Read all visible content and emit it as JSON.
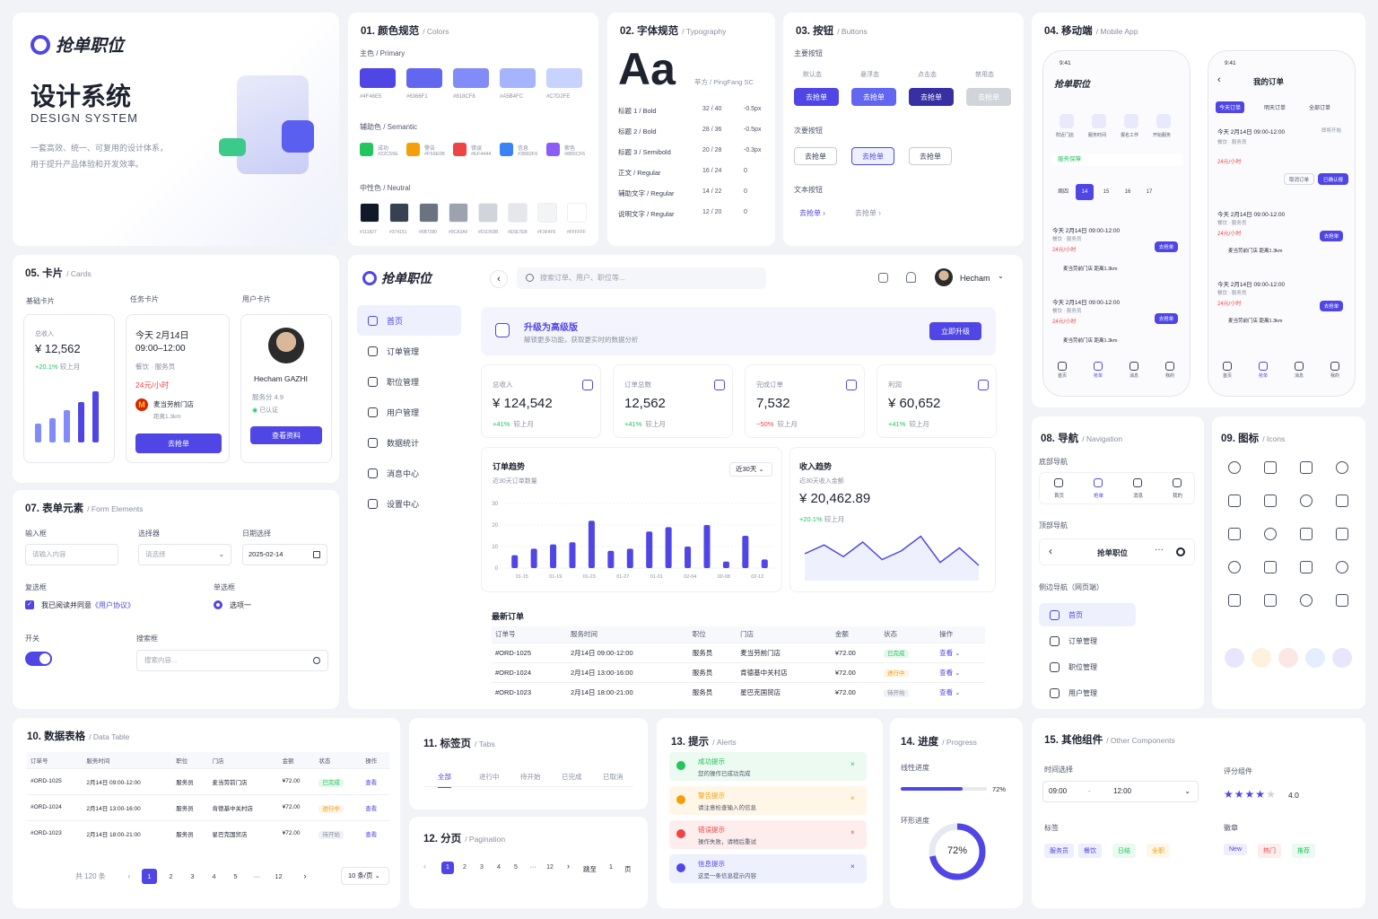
{
  "brand": {
    "name": "抢单职位",
    "title": "设计系统",
    "title_en": "DESIGN SYSTEM",
    "desc1": "一套高效、统一、可复用的设计体系，",
    "desc2": "用于提升产品体验和开发效率。"
  },
  "colors": {
    "header": "01. 颜色规范",
    "header_sub": "/ Colors",
    "primary_label": "主色 / Primary",
    "primary": [
      "#4F46E5",
      "#6366F1",
      "#818CF8",
      "#A5B4FC",
      "#C7D2FE"
    ],
    "semantic_label": "辅助色 / Semantic",
    "semantic": [
      {
        "name": "成功",
        "hex": "#22C55E"
      },
      {
        "name": "警告",
        "hex": "#F59E0B"
      },
      {
        "name": "错误",
        "hex": "#EF4444"
      },
      {
        "name": "信息",
        "hex": "#3B82F6"
      },
      {
        "name": "紫色",
        "hex": "#8B5CF6"
      }
    ],
    "neutral_label": "中性色 / Neutral",
    "neutral": [
      "#111827",
      "#374151",
      "#6B7280",
      "#9CA3AF",
      "#D1D5DB",
      "#E5E7EB",
      "#F3F4F6",
      "#FFFFFF"
    ]
  },
  "typography": {
    "header": "02. 字体规范",
    "header_sub": "/ Typography",
    "sample": "Aa",
    "font": "苹方 / PingFang SC",
    "rows": [
      [
        "标题 1 / Bold",
        "32 / 40",
        "-0.5px"
      ],
      [
        "标题 2 / Bold",
        "28 / 36",
        "-0.5px"
      ],
      [
        "标题 3 / Semibold",
        "20 / 28",
        "-0.3px"
      ],
      [
        "正文 / Regular",
        "16 / 24",
        "0"
      ],
      [
        "辅助文字 / Regular",
        "14 / 22",
        "0"
      ],
      [
        "说明文字 / Regular",
        "12 / 20",
        "0"
      ]
    ]
  },
  "buttons": {
    "header": "03. 按钮",
    "header_sub": "/ Buttons",
    "primary_label": "主要按钮",
    "states": [
      "默认态",
      "悬浮态",
      "点击态",
      "禁用态"
    ],
    "label": "去抢单",
    "secondary_label": "次要按钮",
    "text_label": "文本按钮",
    "text_btn": "去抢单 ›"
  },
  "mobile": {
    "header": "04. 移动端",
    "header_sub": "/ Mobile App",
    "time": "9:41",
    "brand": "抢单职位",
    "orders_title": "我的订单",
    "tabs": [
      "今天订单",
      "明天订单",
      "全部订单"
    ],
    "home_tabs": [
      "附近门店",
      "服务时间",
      "报名工作",
      "开始服务"
    ],
    "banner": "服务保障",
    "dates": [
      "周四",
      "14",
      "15",
      "16",
      "17"
    ],
    "job_time": "今天 2月14日 09:00-12:00",
    "job_role": "餐饮 · 服务员",
    "job_price": "24元/小时",
    "job_store": "麦当劳前门店",
    "job_dist": "距离1.3km",
    "grab": "去抢单",
    "order_btn": "已确认报",
    "order_status": "即将开始",
    "order_cancel": "取消订单",
    "nav": [
      "首页",
      "抢单",
      "消息",
      "我的"
    ]
  },
  "cards": {
    "header": "05. 卡片",
    "header_sub": "/ Cards",
    "labels": [
      "基础卡片",
      "任务卡片",
      "用户卡片"
    ],
    "income_label": "总收入",
    "income": "¥ 12,562",
    "growth": "+20.1%",
    "compare": "较上月",
    "task_date": "今天 2月14日",
    "task_time": "09:00–12:00",
    "task_role": "餐饮 · 服务员",
    "task_price": "24元/小时",
    "task_store": "麦当劳前门店",
    "task_dist": "距离1.3km",
    "task_btn": "去抢单",
    "user_name": "Hecham GAZHI",
    "user_score": "服务分 4.9",
    "user_cert": "已认证",
    "user_btn": "查看资料",
    "bars": [
      0.35,
      0.45,
      0.6,
      0.75,
      0.95
    ]
  },
  "dashboard": {
    "brand": "抢单职位",
    "search_placeholder": "搜索订单、用户、职位等...",
    "user": "Hecham",
    "nav": [
      "首页",
      "订单管理",
      "职位管理",
      "用户管理",
      "数据统计",
      "消息中心",
      "设置中心"
    ],
    "upgrade_title": "升级为高级版",
    "upgrade_desc": "解锁更多功能，获取更实时的数据分析",
    "upgrade_btn": "立即升级",
    "stats": [
      {
        "label": "总收入",
        "value": "¥ 124,542",
        "delta": "+41%",
        "cmp": "较上月",
        "up": true
      },
      {
        "label": "订单总数",
        "value": "12,562",
        "delta": "+41%",
        "cmp": "较上月",
        "up": true
      },
      {
        "label": "完成订单",
        "value": "7,532",
        "delta": "−50%",
        "cmp": "较上月",
        "up": false
      },
      {
        "label": "利润",
        "value": "¥ 60,652",
        "delta": "+41%",
        "cmp": "较上月",
        "up": true
      }
    ],
    "order_trend": "订单趋势",
    "order_trend_sub": "近30天订单数量",
    "range": "近30天",
    "income_trend": "收入趋势",
    "income_trend_sub": "近30天收入金额",
    "income_value": "¥ 20,462.89",
    "income_delta": "+20.1%",
    "income_cmp": "较上月",
    "recent": "最新订单",
    "table_head": [
      "订单号",
      "服务时间",
      "职位",
      "门店",
      "金额",
      "状态",
      "操作"
    ],
    "rows": [
      [
        "#ORD-1025",
        "2月14日 09:00-12:00",
        "服务员",
        "麦当劳前门店",
        "¥72.00",
        "已完成",
        "查看"
      ],
      [
        "#ORD-1024",
        "2月14日 13:00-16:00",
        "服务员",
        "肯德基中关村店",
        "¥72.00",
        "进行中",
        "查看"
      ],
      [
        "#ORD-1023",
        "2月14日 18:00-21:00",
        "服务员",
        "星巴克国贸店",
        "¥72.00",
        "待开始",
        "查看"
      ]
    ]
  },
  "chart_data": {
    "type": "bar",
    "categories": [
      "01-15",
      "01-19",
      "01-23",
      "01-27",
      "01-31",
      "02-04",
      "02-08",
      "02-12"
    ],
    "ylim": [
      0,
      30
    ],
    "yticks": [
      0,
      10,
      20,
      30
    ],
    "values": [
      6,
      9,
      11,
      12,
      22,
      8,
      9,
      17,
      19,
      10,
      20,
      3,
      15,
      4
    ]
  },
  "line_chart": {
    "type": "line",
    "values": [
      40,
      55,
      35,
      60,
      30,
      45,
      70,
      25,
      50,
      20
    ]
  },
  "forms": {
    "header": "07. 表单元素",
    "header_sub": "/ Form Elements",
    "input_label": "输入框",
    "input_ph": "请输入内容",
    "select_label": "选择器",
    "select_ph": "请选择",
    "date_label": "日期选择",
    "date_value": "2025-02-14",
    "checkbox_label": "复选框",
    "checkbox_text": "我已阅读并同意",
    "checkbox_link": "《用户协议》",
    "radio_label": "单选框",
    "radio_text": "选项一",
    "switch_label": "开关",
    "search_label": "搜索框",
    "search_ph": "搜索内容..."
  },
  "navigation": {
    "header": "08. 导航",
    "header_sub": "/ Navigation",
    "bottom": "底部导航",
    "top": "顶部导航",
    "side": "侧边导航（网页端）",
    "items": [
      "首页",
      "抢单",
      "消息",
      "我的"
    ],
    "top_title": "抢单职位",
    "side_items": [
      "首页",
      "订单管理",
      "职位管理",
      "用户管理"
    ]
  },
  "icons": {
    "header": "09. 图标",
    "header_sub": "/ Icons"
  },
  "table": {
    "header": "10. 数据表格",
    "header_sub": "/ Data Table",
    "total": "共 120 条",
    "pages": [
      "1",
      "2",
      "3",
      "4",
      "5",
      "···",
      "12"
    ],
    "per_page": "10 条/页"
  },
  "tabs": {
    "header": "11. 标签页",
    "header_sub": "/ Tabs",
    "items": [
      "全部",
      "进行中",
      "待开始",
      "已完成",
      "已取消"
    ]
  },
  "pagination": {
    "header": "12. 分页",
    "header_sub": "/ Pagination",
    "pages": [
      "1",
      "2",
      "3",
      "4",
      "5",
      "···",
      "12"
    ],
    "jump": "跳至",
    "jump_value": "1",
    "page_unit": "页"
  },
  "alerts": {
    "header": "13. 提示",
    "header_sub": "/ Alerts",
    "items": [
      {
        "title": "成功提示",
        "desc": "您的操作已成功完成",
        "color": "#22C55E",
        "bg": "#ECFAF1"
      },
      {
        "title": "警告提示",
        "desc": "请注意检查输入的信息",
        "color": "#F59E0B",
        "bg": "#FFF6E8"
      },
      {
        "title": "错误提示",
        "desc": "操作失败，请稍后重试",
        "color": "#EF4444",
        "bg": "#FDEDED"
      },
      {
        "title": "信息提示",
        "desc": "这是一条信息提示内容",
        "color": "#4F46E5",
        "bg": "#EEF0FE"
      }
    ]
  },
  "progress": {
    "header": "14. 进度",
    "header_sub": "/ Progress",
    "linear": "线性进度",
    "linear_value": 0.72,
    "linear_text": "72%",
    "ring": "环形进度",
    "ring_value": 0.72,
    "ring_text": "72%"
  },
  "other": {
    "header": "15. 其他组件",
    "header_sub": "/ Other Components",
    "time_label": "时间选择",
    "time_from": "09:00",
    "time_sep": "-",
    "time_to": "12:00",
    "rating_label": "评分组件",
    "rating": 4.0,
    "rating_text": "4.0",
    "tag_label": "标签",
    "tags": [
      "服务员",
      "餐饮",
      "日结",
      "全职"
    ],
    "badge_label": "徽章",
    "badges": [
      "New",
      "热门",
      "推荐"
    ]
  }
}
